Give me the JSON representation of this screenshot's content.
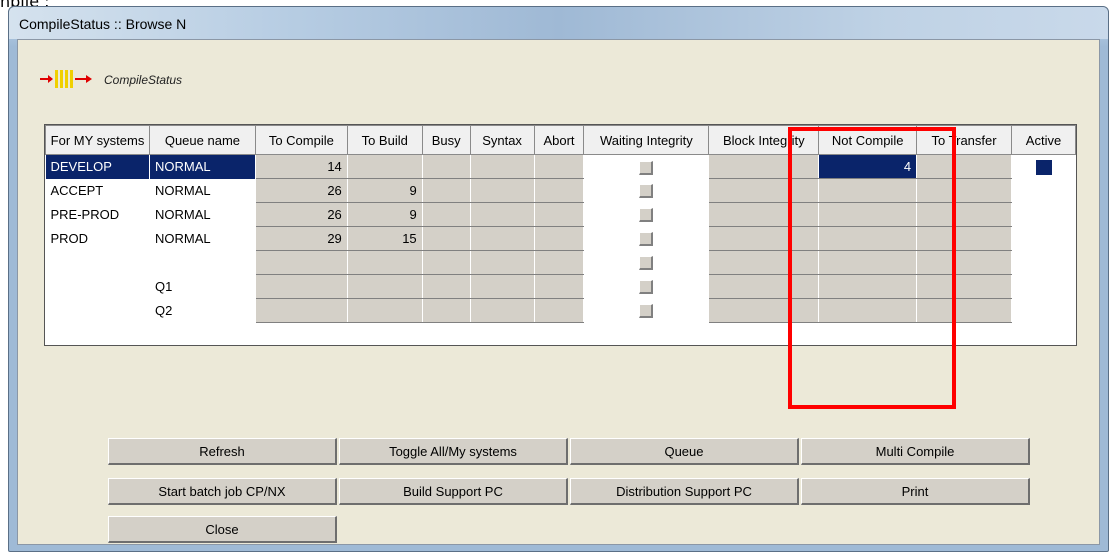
{
  "crop_text": "npile :",
  "window": {
    "title": "CompileStatus :: Browse N"
  },
  "logo": {
    "label": "CompileStatus"
  },
  "table": {
    "headers": [
      "For MY systems",
      "Queue name",
      "To Compile",
      "To Build",
      "Busy",
      "Syntax",
      "Abort",
      "Waiting Integrity",
      "Block Integrity",
      "Not Compile",
      "To Transfer",
      "Active"
    ],
    "rows": [
      {
        "system": "DEVELOP",
        "queue": "NORMAL",
        "to_compile": "14",
        "to_build": "",
        "not_compile": "4",
        "active": true,
        "selected": true
      },
      {
        "system": "ACCEPT",
        "queue": "NORMAL",
        "to_compile": "26",
        "to_build": "9",
        "not_compile": "",
        "active": false,
        "selected": false
      },
      {
        "system": "PRE-PROD",
        "queue": "NORMAL",
        "to_compile": "26",
        "to_build": "9",
        "not_compile": "",
        "active": false,
        "selected": false
      },
      {
        "system": "PROD",
        "queue": "NORMAL",
        "to_compile": "29",
        "to_build": "15",
        "not_compile": "",
        "active": false,
        "selected": false
      },
      {
        "system": "",
        "queue": "",
        "to_compile": "",
        "to_build": "",
        "not_compile": "",
        "active": false,
        "selected": false
      },
      {
        "system": "",
        "queue": "Q1",
        "to_compile": "",
        "to_build": "",
        "not_compile": "",
        "active": false,
        "selected": false
      },
      {
        "system": "",
        "queue": "Q2",
        "to_compile": "",
        "to_build": "",
        "not_compile": "",
        "active": false,
        "selected": false
      }
    ]
  },
  "buttons": {
    "refresh": "Refresh",
    "toggle": "Toggle All/My systems",
    "queue": "Queue",
    "multi_compile": "Multi Compile",
    "start_batch": "Start batch job CP/NX",
    "build_support": "Build Support PC",
    "distribution_support": "Distribution Support PC",
    "print": "Print",
    "close": "Close"
  },
  "colors": {
    "selection": "#0a246a",
    "highlight_box": "#ff0000",
    "dialog_bg": "#ece9d8"
  }
}
